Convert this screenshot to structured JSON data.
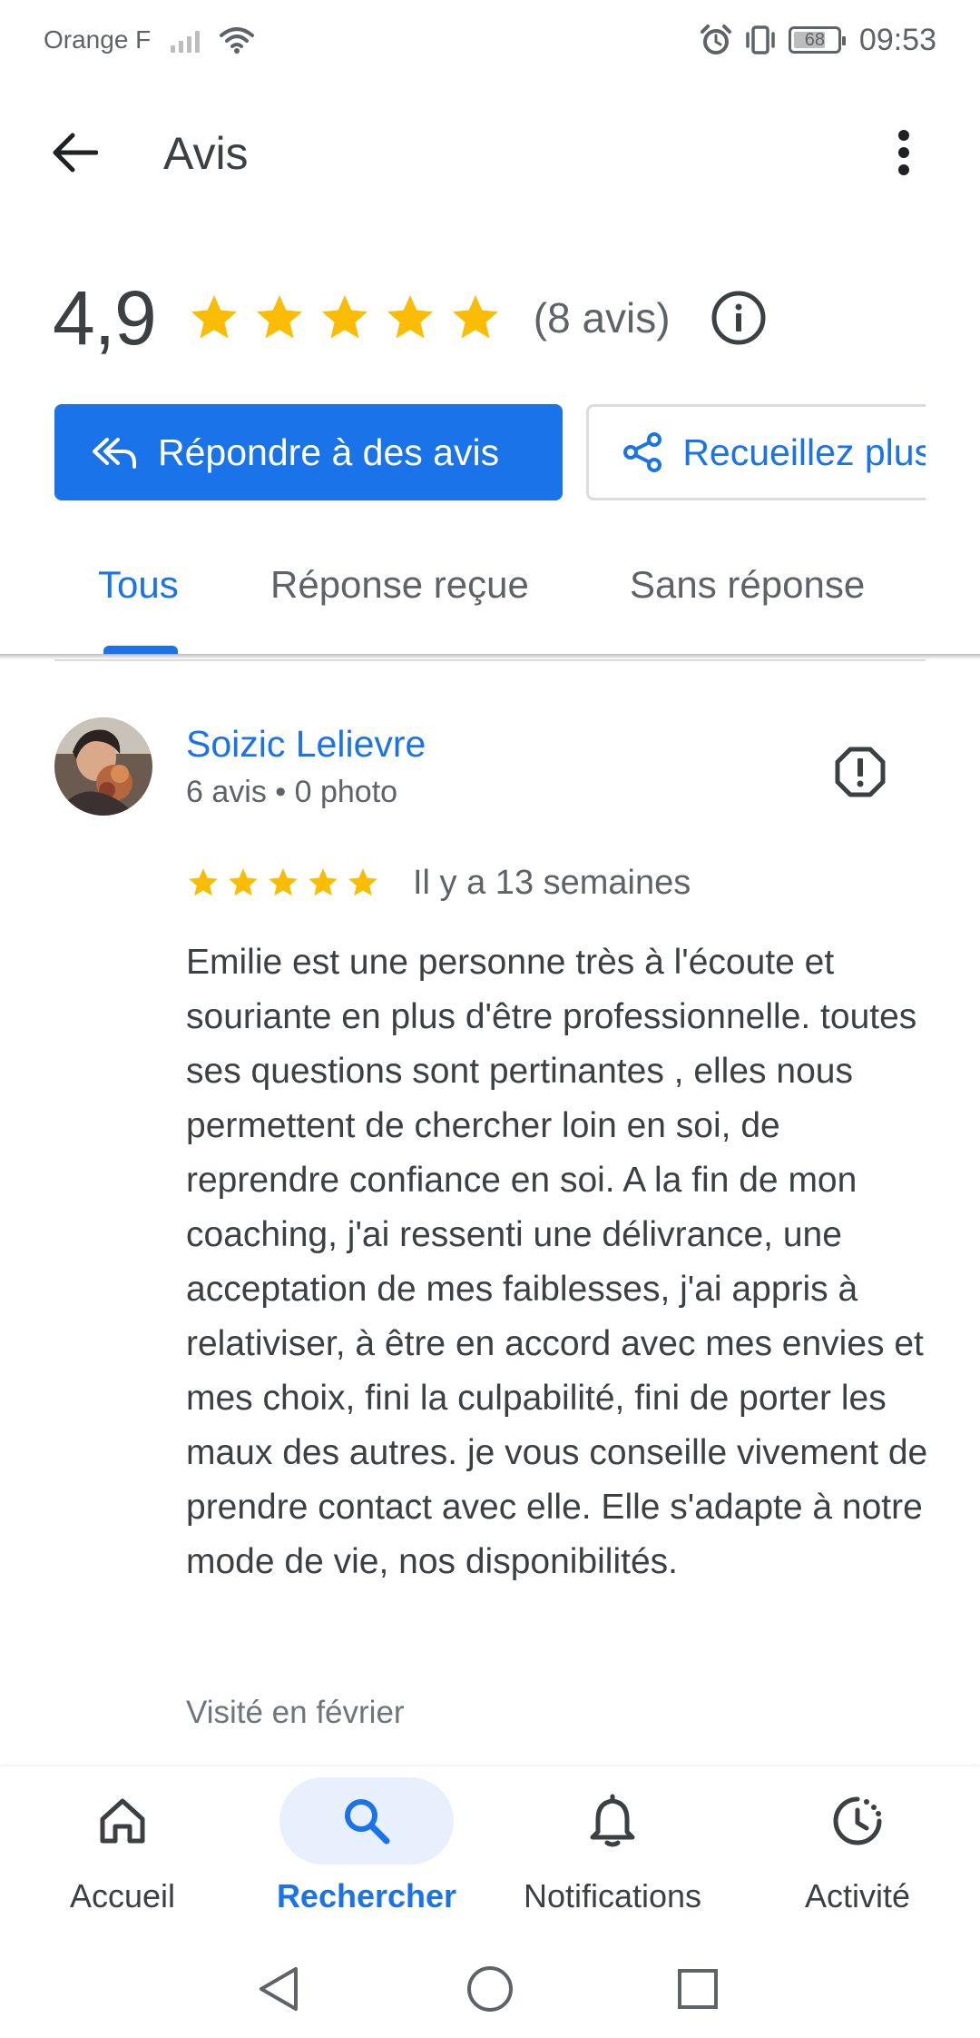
{
  "status_bar": {
    "carrier": "Orange F",
    "battery": "68",
    "time": "09:53"
  },
  "app_bar": {
    "title": "Avis",
    "back_icon": "arrow-back-icon",
    "more_icon": "more-vert-icon"
  },
  "summary": {
    "rating": "4,9",
    "stars": 5,
    "count_label": "(8 avis)",
    "info_icon": "info-icon"
  },
  "actions": {
    "reply_label": "Répondre à des avis",
    "collect_label": "Recueillez plus d'avis"
  },
  "tabs": [
    {
      "label": "Tous",
      "active": true
    },
    {
      "label": "Réponse reçue",
      "active": false
    },
    {
      "label": "Sans réponse",
      "active": false
    }
  ],
  "review": {
    "author": "Soizic Lelievre",
    "meta": "6 avis • 0 photo",
    "stars": 5,
    "date": "Il y a 13 semaines",
    "text": "Emilie est une personne très à l'écoute et souriante en plus d'être professionnelle. toutes ses questions sont pertinantes , elles nous permettent de chercher loin en soi, de reprendre confiance en soi. A la fin de mon coaching, j'ai ressenti une délivrance, une acceptation de mes faiblesses, j'ai appris à relativiser, à être en accord avec mes envies et mes choix, fini la culpabilité, fini de porter les maux des autres. je vous conseille vivement de prendre contact avec elle. Elle s'adapte à notre mode de vie, nos disponibilités.",
    "visited": "Visité en février"
  },
  "bottom_nav": [
    {
      "label": "Accueil",
      "icon": "home-icon",
      "active": false
    },
    {
      "label": "Rechercher",
      "icon": "search-icon",
      "active": true
    },
    {
      "label": "Notifications",
      "icon": "bell-icon",
      "active": false
    },
    {
      "label": "Activité",
      "icon": "activity-icon",
      "active": false
    }
  ],
  "colors": {
    "accent": "#1a73e8",
    "star": "#fbbc04",
    "text_primary": "#3c4043",
    "text_secondary": "#5f6368",
    "active_pill": "#e8f0fe"
  }
}
